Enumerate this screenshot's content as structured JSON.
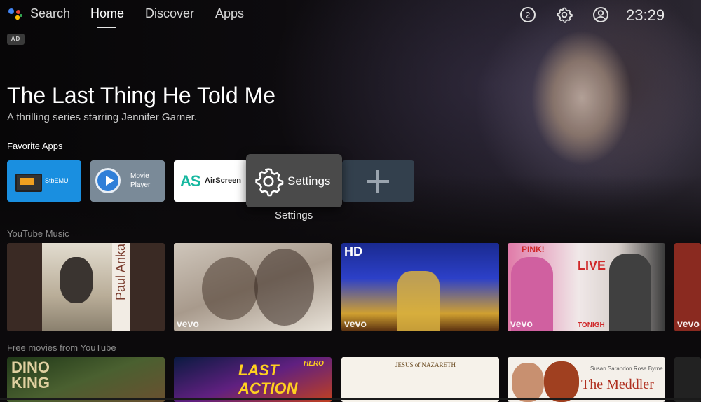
{
  "topbar": {
    "search": "Search",
    "home": "Home",
    "discover": "Discover",
    "apps": "Apps",
    "notification_count": "2",
    "clock": "23:29"
  },
  "ad_badge": "AD",
  "hero": {
    "title": "The Last Thing He Told Me",
    "subtitle": "A thrilling series starring Jennifer Garner."
  },
  "favorite_apps": {
    "title": "Favorite Apps",
    "stbemu": "StbEMU",
    "movie_player": "Movie\nPlayer",
    "airscreen": "AirScreen",
    "settings": "Settings",
    "settings_caption": "Settings"
  },
  "youtube_music": {
    "title": "YouTube Music",
    "t1_name": "Paul Anka",
    "t3_hd": "HD",
    "t4_live": "LIVE",
    "t4_pink": "PINK!",
    "t4_tonight": "TONIGH",
    "vevo": "vevo"
  },
  "free_movies": {
    "title": "Free movies from YouTube",
    "f1": "DINO\nKING",
    "f2": "LAST ACTION",
    "f2_sub": "HERO",
    "f3": "JESUS of NAZARETH",
    "f4": "The Meddler",
    "f4_names": "Susan Sarandon   Rose Byrne   J.K. Simmons"
  },
  "colors": {
    "stbemu_tile": "#1a8fe0",
    "settings_tile": "#4a4a4a",
    "airscreen_accent": "#17b8a0"
  },
  "icons": [
    "assistant-icon",
    "notification-icon",
    "gear-icon",
    "account-icon",
    "settings-gear-icon",
    "plus-icon"
  ]
}
